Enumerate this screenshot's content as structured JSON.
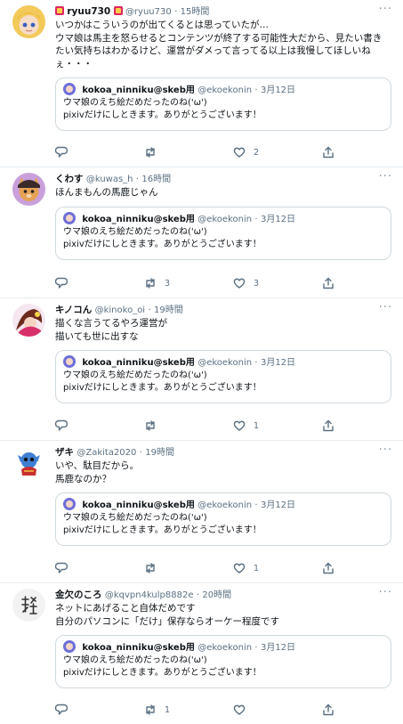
{
  "tweets": [
    {
      "name": "ryuu730",
      "handle": "@ryuu730",
      "time": "15時間",
      "text": "いつかはこういうのが出てくるとは思っていたが…\nウマ娘は馬主を怒らせるとコンテンツが終了する可能性大だから、見たい書きたい気持ちはわかるけど、運営がダメって言ってる以上は我慢してほしいねぇ・・・",
      "quote": {
        "name": "kokoa_ninniku@skeb用",
        "handle": "@ekoekonin",
        "date": "3月12日",
        "text": "ウマ娘のえち絵だめだったのね('ω')\npixivだけにしときます。ありがとうございます！"
      },
      "replies": "",
      "retweets": "",
      "likes": "2"
    },
    {
      "name": "くわす",
      "handle": "@kuwas_h",
      "time": "16時間",
      "text": "ほんまもんの馬鹿じゃん",
      "quote": {
        "name": "kokoa_ninniku@skeb用",
        "handle": "@ekoekonin",
        "date": "3月12日",
        "text": "ウマ娘のえち絵だめだったのね('ω')\npixivだけにしときます。ありがとうございます！"
      },
      "replies": "",
      "retweets": "3",
      "likes": "3"
    },
    {
      "name": "キノコん",
      "handle": "@kinoko_oi",
      "time": "19時間",
      "text": "描くな言うてるやろ運営が\n描いても世に出すな",
      "quote": {
        "name": "kokoa_ninniku@skeb用",
        "handle": "@ekoekonin",
        "date": "3月12日",
        "text": "ウマ娘のえち絵だめだったのね('ω')\npixivだけにしときます。ありがとうございます！"
      },
      "replies": "",
      "retweets": "",
      "likes": "1"
    },
    {
      "name": "ザキ",
      "handle": "@Zakita2020",
      "time": "19時間",
      "text": "いや、駄目だから。\n馬鹿なのか？",
      "quote": {
        "name": "kokoa_ninniku@skeb用",
        "handle": "@ekoekonin",
        "date": "3月12日",
        "text": "ウマ娘のえち絵だめだったのね('ω')\npixivだけにしときます。ありがとうございます！"
      },
      "replies": "",
      "retweets": "",
      "likes": "1"
    },
    {
      "name": "金欠のころ",
      "handle": "@kqvpn4kulp8882e",
      "time": "20時間",
      "text": "ネットにあげること自体だめです\n自分のパソコンに「だけ」保存ならオーケー程度です",
      "quote": {
        "name": "kokoa_ninniku@skeb用",
        "handle": "@ekoekonin",
        "date": "3月12日",
        "text": "ウマ娘のえち絵だめだったのね('ω')\npixivだけにしときます。ありがとうございます！"
      },
      "replies": "",
      "retweets": "1",
      "likes": ""
    }
  ],
  "separator": "·",
  "more_glyph": "···",
  "colors": {
    "accent": "#1da1f2",
    "secondary_text": "#5b7083",
    "border": "#cfd9de"
  }
}
